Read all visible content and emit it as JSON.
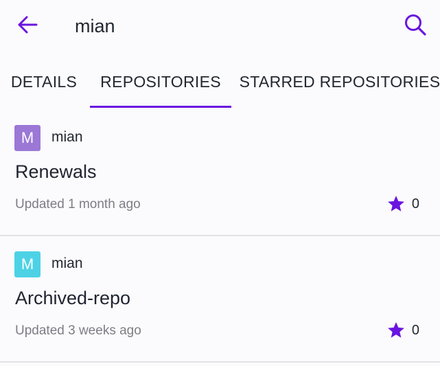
{
  "colors": {
    "accent": "#6a14e0",
    "avatar_1": "#9b77d6",
    "avatar_2": "#4dd2e5"
  },
  "header": {
    "title": "mian",
    "back_icon": "arrow-left-icon",
    "search_icon": "search-icon"
  },
  "tabs": [
    {
      "label": "DETAILS",
      "selected": false
    },
    {
      "label": "REPOSITORIES",
      "selected": true
    },
    {
      "label": "STARRED REPOSITORIES",
      "selected": false
    }
  ],
  "repos": [
    {
      "avatar_letter": "M",
      "owner": "mian",
      "name": "Renewals",
      "updated": "Updated 1 month ago",
      "stars": "0"
    },
    {
      "avatar_letter": "M",
      "owner": "mian",
      "name": "Archived-repo",
      "updated": "Updated 3 weeks ago",
      "stars": "0"
    }
  ]
}
